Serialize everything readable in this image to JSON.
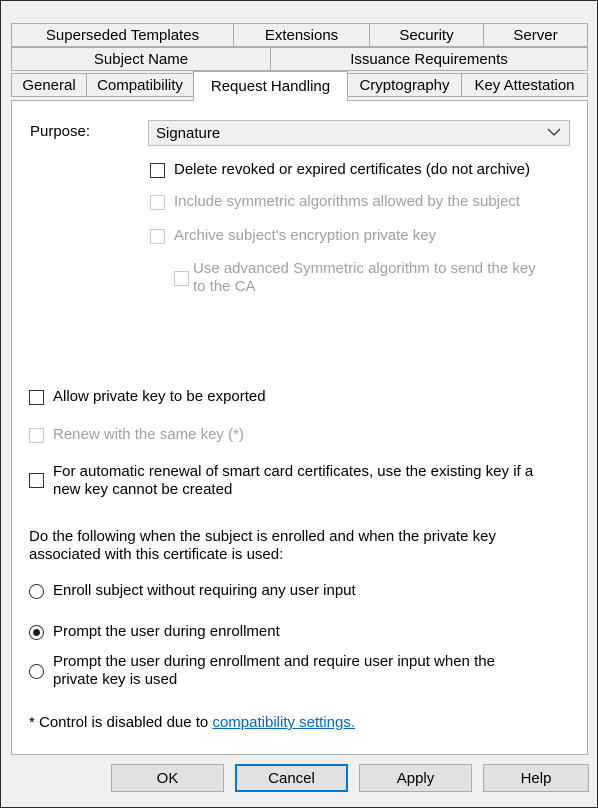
{
  "tabs_row1": [
    "Superseded Templates",
    "Extensions",
    "Security",
    "Server"
  ],
  "tabs_row2": [
    "Subject Name",
    "Issuance Requirements"
  ],
  "tabs_row3": [
    "General",
    "Compatibility",
    "Request Handling",
    "Cryptography",
    "Key Attestation"
  ],
  "active_tab": "Request Handling",
  "purpose": {
    "label": "Purpose:",
    "value": "Signature"
  },
  "options": {
    "delete_revoked": {
      "label": "Delete revoked or expired certificates (do not archive)",
      "checked": false,
      "enabled": true
    },
    "include_symmetric": {
      "label": "Include symmetric algorithms allowed by the subject",
      "checked": false,
      "enabled": false
    },
    "archive_key": {
      "label": "Archive subject's encryption private key",
      "checked": false,
      "enabled": false
    },
    "advanced_symmetric": {
      "line1": "Use advanced Symmetric algorithm to send the key",
      "line2": "to the CA",
      "checked": false,
      "enabled": false
    },
    "allow_export": {
      "label": "Allow private key to be exported",
      "checked": false,
      "enabled": true
    },
    "renew_same_key": {
      "label": "Renew with the same key (*)",
      "checked": false,
      "enabled": false
    },
    "auto_renewal": {
      "line1": "For automatic renewal of smart card certificates, use the existing key if a",
      "line2": "new key cannot be created",
      "checked": false,
      "enabled": true
    }
  },
  "enroll_section": {
    "heading_line1": "Do the following when the subject is enrolled and when the private key",
    "heading_line2": "associated with this certificate is used:",
    "radio_no_input": "Enroll subject without requiring any user input",
    "radio_prompt": "Prompt the user during enrollment",
    "radio_prompt_require_line1": "Prompt the user during enrollment and require user input when the",
    "radio_prompt_require_line2": "private key is used",
    "selected": "Prompt the user during enrollment"
  },
  "footnote": {
    "text": "* Control is disabled due to ",
    "link": "compatibility settings."
  },
  "buttons": {
    "ok": "OK",
    "cancel": "Cancel",
    "apply": "Apply",
    "help": "Help"
  }
}
